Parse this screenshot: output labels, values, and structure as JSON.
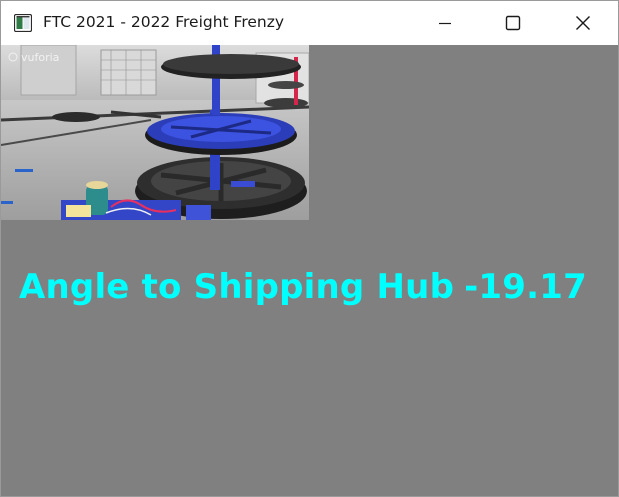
{
  "window": {
    "title": "FTC 2021 - 2022 Freight Frenzy",
    "icons": {
      "app": "app-window-icon",
      "minimize": "minimize-icon",
      "maximize": "maximize-icon",
      "close": "close-icon"
    }
  },
  "camera_feed": {
    "watermark": "vuforia",
    "description_icon": "camera-feed-image"
  },
  "telemetry": {
    "label": "Angle to Shipping Hub",
    "value": "-19.17",
    "color": "#00ffff"
  },
  "colors": {
    "background": "#808080",
    "titlebar": "#ffffff"
  }
}
